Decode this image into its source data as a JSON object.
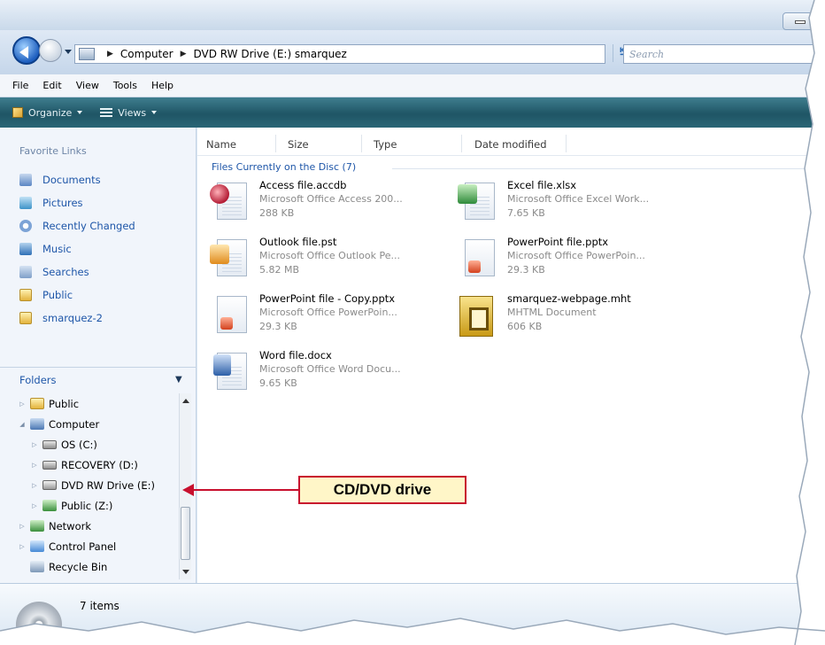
{
  "address_bar": {
    "crumbs": [
      "Computer",
      "DVD RW Drive (E:) smarquez"
    ],
    "search_placeholder": "Search"
  },
  "menu": [
    "File",
    "Edit",
    "View",
    "Tools",
    "Help"
  ],
  "command_bar": {
    "organize": "Organize",
    "views": "Views"
  },
  "favorite_links": {
    "title": "Favorite Links",
    "items": [
      "Documents",
      "Pictures",
      "Recently Changed",
      "Music",
      "Searches",
      "Public",
      "smarquez-2"
    ]
  },
  "folders": {
    "title": "Folders",
    "tree": [
      "Public",
      "Computer",
      "OS (C:)",
      "RECOVERY (D:)",
      "DVD RW Drive (E:)",
      "Public (Z:)",
      "Network",
      "Control Panel",
      "Recycle Bin"
    ]
  },
  "columns": [
    "Name",
    "Size",
    "Type",
    "Date modified"
  ],
  "group_header": "Files Currently on the Disc (7)",
  "files": [
    {
      "name": "Access file.accdb",
      "type": "Microsoft Office Access 200...",
      "size": "288 KB",
      "icon": "access-icon"
    },
    {
      "name": "Excel file.xlsx",
      "type": "Microsoft Office Excel Work...",
      "size": "7.65 KB",
      "icon": "excel-icon"
    },
    {
      "name": "Outlook file.pst",
      "type": "Microsoft Office Outlook Pe...",
      "size": "5.82 MB",
      "icon": "outlook-icon"
    },
    {
      "name": "PowerPoint file.pptx",
      "type": "Microsoft Office PowerPoin...",
      "size": "29.3 KB",
      "icon": "powerpoint-icon"
    },
    {
      "name": "PowerPoint file - Copy.pptx",
      "type": "Microsoft Office PowerPoin...",
      "size": "29.3 KB",
      "icon": "powerpoint-icon"
    },
    {
      "name": "smarquez-webpage.mht",
      "type": "MHTML Document",
      "size": "606 KB",
      "icon": "mhtml-icon"
    },
    {
      "name": "Word file.docx",
      "type": "Microsoft Office Word Docu...",
      "size": "9.65 KB",
      "icon": "word-icon"
    }
  ],
  "status": {
    "item_count": "7 items"
  },
  "callout": {
    "label": "CD/DVD drive",
    "border_color": "#c8102e",
    "fill_color": "#fff6c8"
  }
}
